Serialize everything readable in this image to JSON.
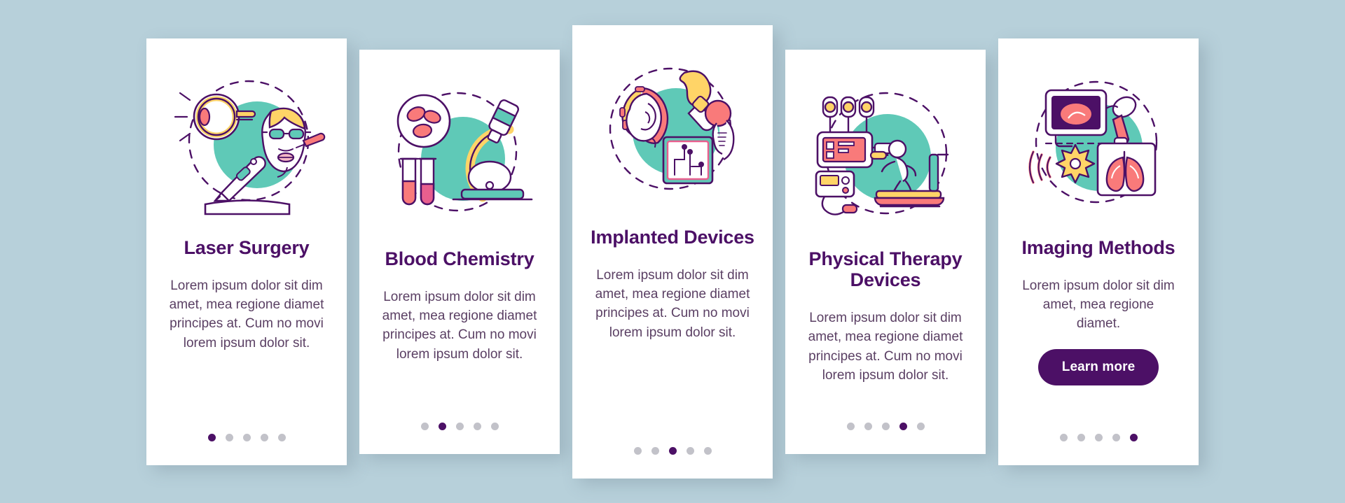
{
  "background_color": "#b7d0da",
  "theme": {
    "card_background": "#ffffff",
    "title_color": "#4c1066",
    "body_color": "#5a3f63",
    "accent_purple": "#4c1066",
    "accent_teal": "#5fc9b7",
    "accent_yellow": "#ffd467",
    "accent_coral": "#f97a7a",
    "dot_inactive": "#c2c2c9"
  },
  "cards": [
    {
      "id": "laser-surgery",
      "icon": "eye-laser-surgery-illustration",
      "title": "Laser Surgery",
      "description": "Lorem ipsum dolor sit dim amet, mea regione diamet principes at. Cum no movi lorem ipsum dolor sit.",
      "active_dot": 0,
      "dot_count": 5,
      "button": null
    },
    {
      "id": "blood-chemistry",
      "icon": "microscope-blood-cells-illustration",
      "title": "Blood Chemistry",
      "description": "Lorem ipsum dolor sit dim amet, mea regione diamet principes at. Cum no movi lorem ipsum dolor sit.",
      "active_dot": 1,
      "dot_count": 5,
      "button": null
    },
    {
      "id": "implanted-devices",
      "icon": "hearing-aid-implant-chip-illustration",
      "title": "Implanted Devices",
      "description": "Lorem ipsum dolor sit dim amet, mea regione diamet principes at. Cum no movi lorem ipsum dolor sit.",
      "active_dot": 2,
      "dot_count": 5,
      "button": null
    },
    {
      "id": "physical-therapy-devices",
      "icon": "treadmill-therapy-machine-illustration",
      "title": "Physical Therapy Devices",
      "description": "Lorem ipsum dolor sit dim amet, mea regione diamet principes at. Cum no movi lorem ipsum dolor sit.",
      "active_dot": 3,
      "dot_count": 5,
      "button": null
    },
    {
      "id": "imaging-methods",
      "icon": "ultrasound-xray-lungs-illustration",
      "title": "Imaging Methods",
      "description": "Lorem ipsum dolor sit dim amet, mea regione diamet.",
      "active_dot": 4,
      "dot_count": 5,
      "button": "Learn more"
    }
  ]
}
